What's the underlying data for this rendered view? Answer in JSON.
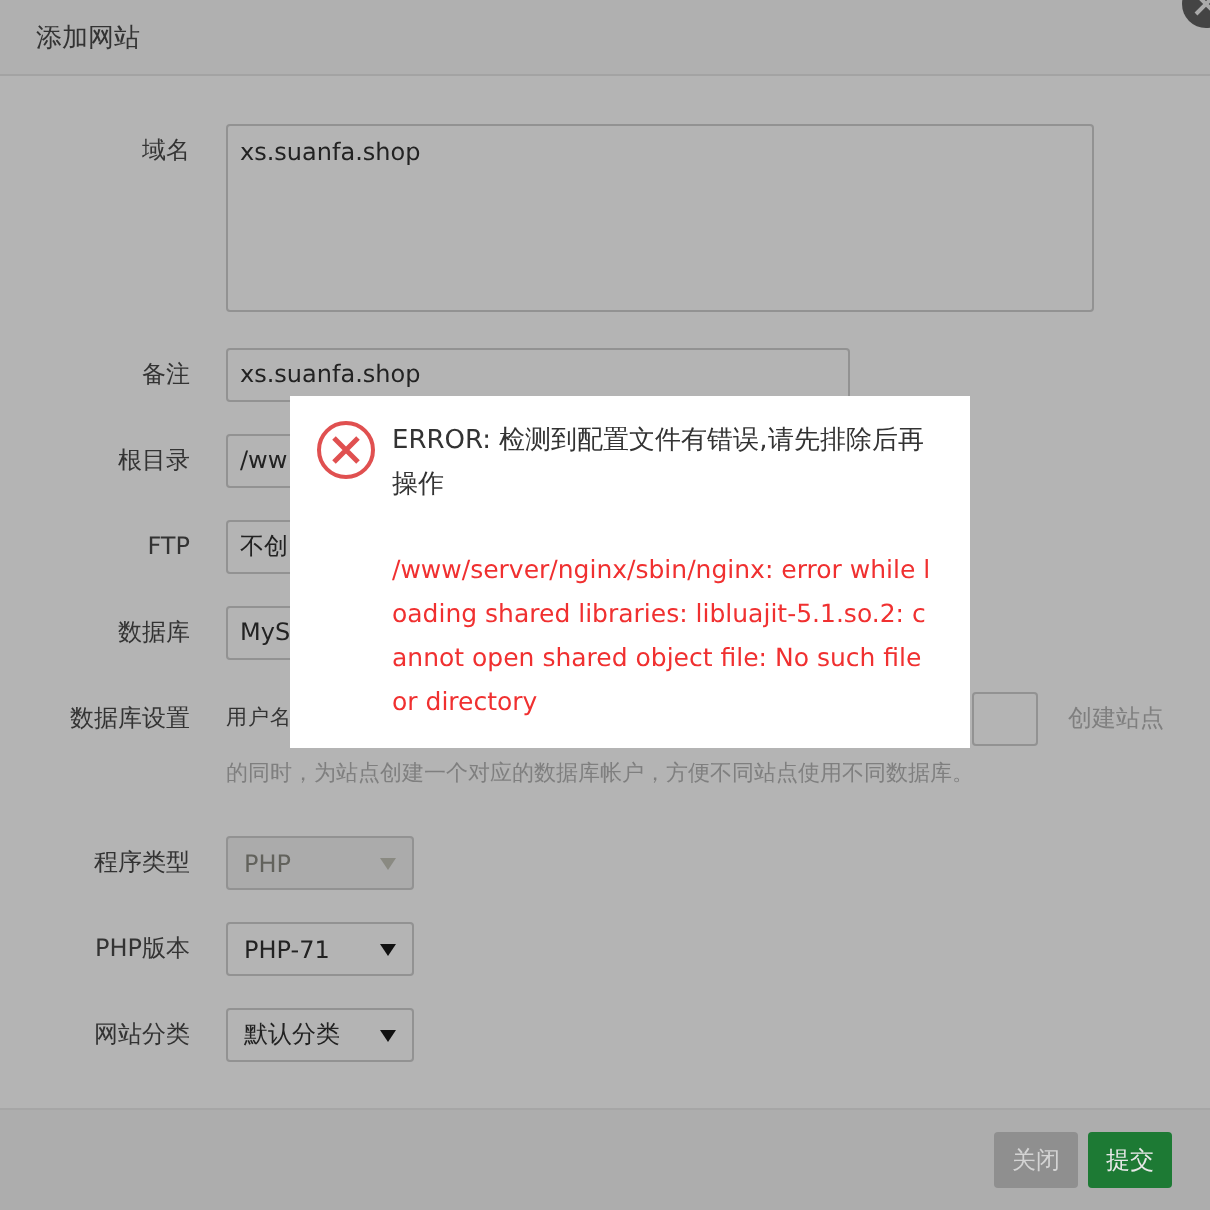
{
  "window": {
    "title": "添加网站"
  },
  "form": {
    "domain": {
      "label": "域名",
      "value": "xs.suanfa.shop"
    },
    "note": {
      "label": "备注",
      "value": "xs.suanfa.shop"
    },
    "covered_rows": [
      {
        "label": "根目录",
        "value": "/ww"
      },
      {
        "label": "FTP",
        "value": "不创"
      },
      {
        "label": "数据库",
        "value": "MyS"
      }
    ],
    "db_settings": {
      "label": "数据库设置",
      "user_label": "用户名",
      "hint_right": "创建站点",
      "hint_line": "的同时，为站点创建一个对应的数据库帐户，方便不同站点使用不同数据库。"
    },
    "selects": [
      {
        "label": "程序类型",
        "value": "PHP",
        "disabled": true
      },
      {
        "label": "PHP版本",
        "value": "PHP-71",
        "disabled": false
      },
      {
        "label": "网站分类",
        "value": "默认分类",
        "disabled": false
      }
    ]
  },
  "buttons": [
    {
      "label": "关闭",
      "kind": "secondary"
    },
    {
      "label": "提交",
      "kind": "primary"
    }
  ],
  "error_dialog": {
    "title": "ERROR: 检测到配置文件有错误,请先排除后再操作",
    "detail": "/www/server/nginx/sbin/nginx: error while loading shared libraries: libluajit-5.1.so.2: cannot open shared object file: No such file or directory"
  }
}
